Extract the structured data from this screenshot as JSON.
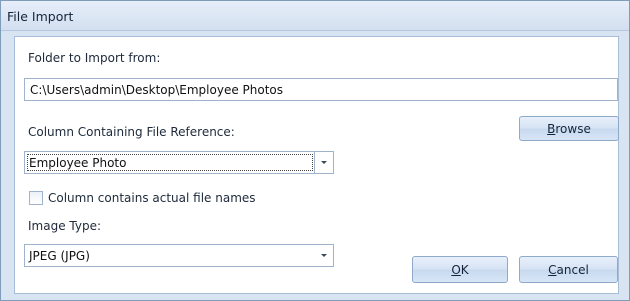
{
  "window": {
    "title": "File Import"
  },
  "folder": {
    "label": "Folder to Import from:",
    "value": "C:\\Users\\admin\\Desktop\\Employee Photos"
  },
  "column": {
    "label": "Column Containing File Reference:",
    "selected": "Employee Photo"
  },
  "checkbox": {
    "label": "Column contains actual file names",
    "checked": false
  },
  "image_type": {
    "label": "Image Type:",
    "selected": "JPEG (JPG)"
  },
  "buttons": {
    "browse": {
      "mnemonic": "B",
      "rest": "rowse"
    },
    "ok": {
      "mnemonic": "O",
      "rest": "K"
    },
    "cancel": {
      "mnemonic": "C",
      "rest": "ancel"
    }
  },
  "colors": {
    "dialog_background": "#d9e4f2",
    "panel_background": "#ffffff",
    "border": "#9fb4cc"
  }
}
